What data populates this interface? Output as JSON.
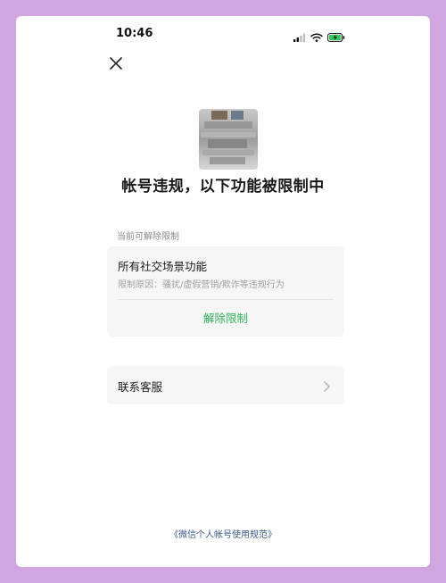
{
  "status_bar": {
    "time": "10:46"
  },
  "page": {
    "title": "帐号违规，以下功能被限制中"
  },
  "restrictions": {
    "section_label": "当前可解除限制",
    "item": {
      "name": "所有社交场景功能",
      "reason": "限制原因：骚扰/虚假营销/欺诈等违规行为",
      "action_label": "解除限制",
      "action_color": "#31b35c"
    }
  },
  "contact": {
    "label": "联系客服"
  },
  "footer": {
    "link_text": "《微信个人帐号使用规范》"
  },
  "colors": {
    "frame": "#cfa6e0",
    "link": "#3e5a86"
  },
  "icons": {
    "close": "close-icon",
    "chevron": "chevron-right-icon",
    "signal": "signal-icon",
    "wifi": "wifi-icon",
    "battery": "battery-charging-icon"
  }
}
